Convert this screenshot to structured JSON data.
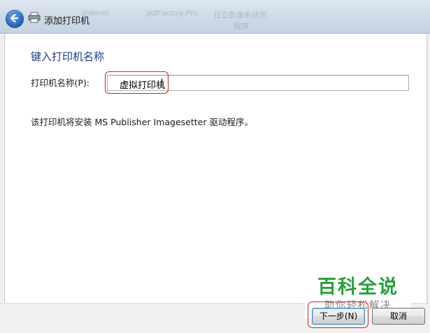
{
  "window": {
    "title": "添加打印机",
    "background_items": [
      "Internet",
      "pdfFactory Pro",
      "日立影像系统常",
      "程序"
    ]
  },
  "content": {
    "heading": "键入打印机名称",
    "printer_name_label": "打印机名称(P):",
    "printer_name_value": "虚拟打印机",
    "driver_info": "该打印机将安装 MS Publisher Imagesetter 驱动程序。"
  },
  "buttons": {
    "next_label": "下一步(N)",
    "cancel_label": "取消"
  },
  "watermark": {
    "main": "百科全说",
    "sub": "助你轻松解决"
  },
  "colors": {
    "heading": "#1e3a8a",
    "highlight": "#d32020",
    "watermark_main": "#27a13a"
  }
}
